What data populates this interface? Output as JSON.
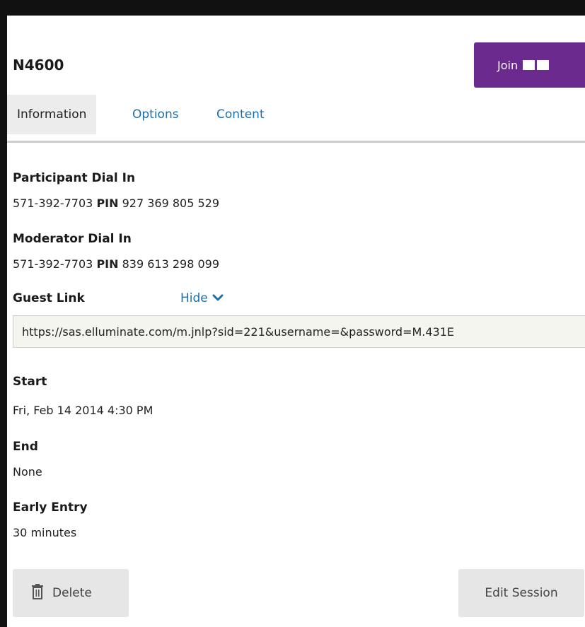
{
  "session": {
    "title": "N4600",
    "join_label": "Join"
  },
  "tabs": [
    {
      "label": "Information",
      "active": true
    },
    {
      "label": "Options",
      "active": false
    },
    {
      "label": "Content",
      "active": false
    }
  ],
  "participant": {
    "label": "Participant Dial In",
    "phone": "571-392-7703",
    "pin_label": "PIN",
    "pin": "927 369 805 529"
  },
  "moderator": {
    "label": "Moderator Dial In",
    "phone": "571-392-7703",
    "pin_label": "PIN",
    "pin": "839 613 298 099"
  },
  "guest_link": {
    "label": "Guest Link",
    "toggle_label": "Hide",
    "value": "https://sas.elluminate.com/m.jnlp?sid=221&username=&password=M.431E"
  },
  "start": {
    "label": "Start",
    "value": "Fri, Feb 14 2014 4:30 PM"
  },
  "end": {
    "label": "End",
    "value": "None"
  },
  "early_entry": {
    "label": "Early Entry",
    "value": "30 minutes"
  },
  "actions": {
    "delete_label": "Delete",
    "edit_label": "Edit Session"
  },
  "colors": {
    "accent": "#6a2a8e",
    "link": "#1f6fa8"
  },
  "icons": {
    "join": "layout-columns-icon",
    "hide": "chevron-down-icon",
    "delete": "trash-icon"
  }
}
